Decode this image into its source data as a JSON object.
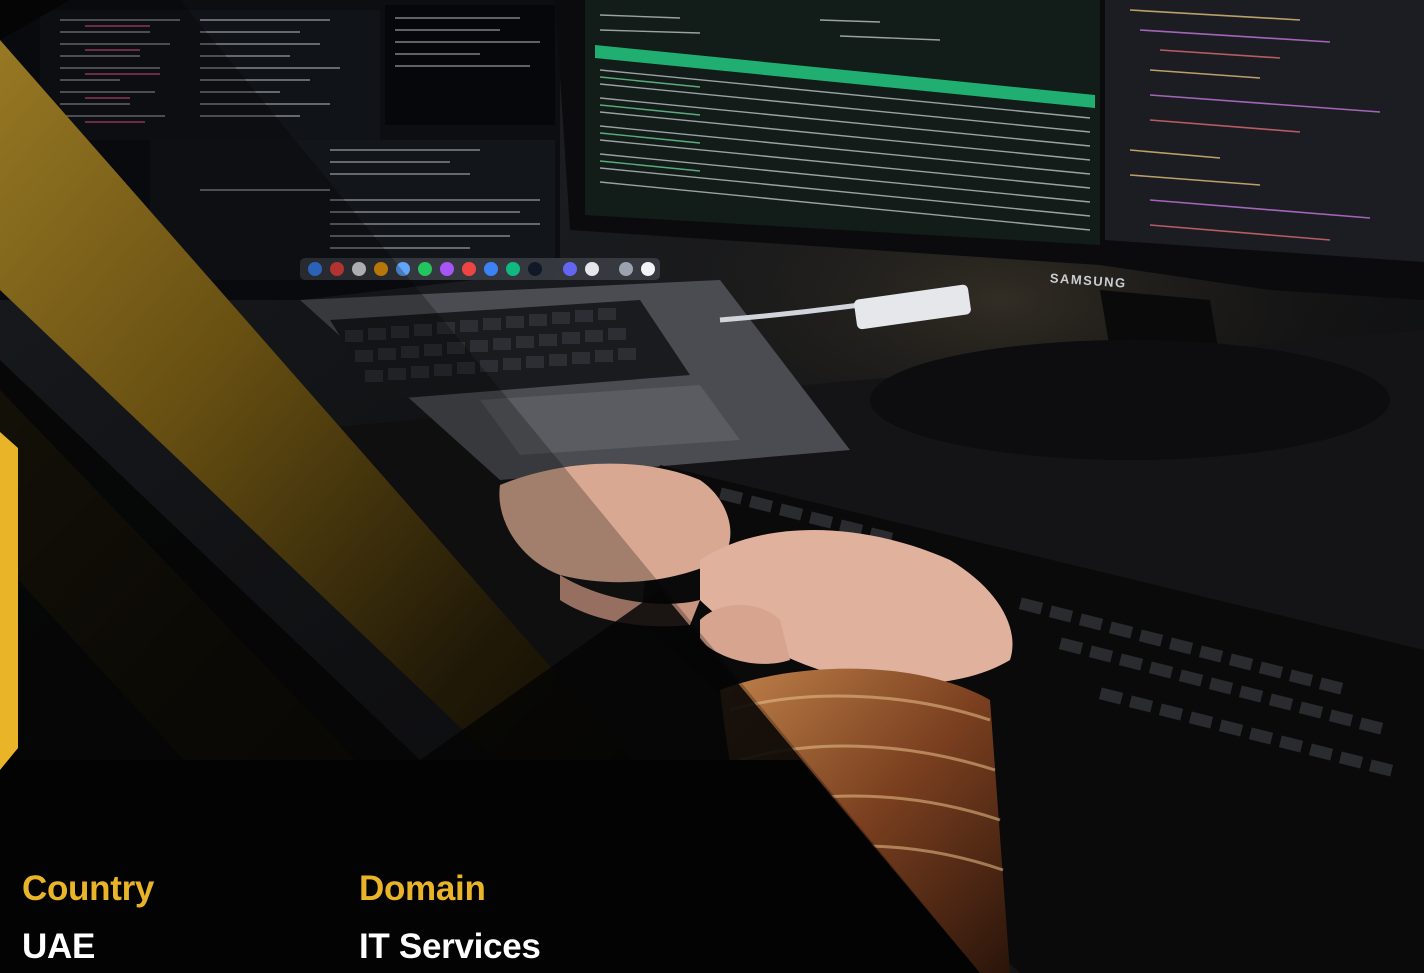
{
  "photo": {
    "monitor_brand": "SAMSUNG"
  },
  "info": {
    "country_label": "Country",
    "country_value": "UAE",
    "domain_label": "Domain",
    "domain_value": "IT Services"
  },
  "colors": {
    "accent_gold": "#e9b428",
    "background_dark": "#070707",
    "text_light": "#ffffff"
  }
}
